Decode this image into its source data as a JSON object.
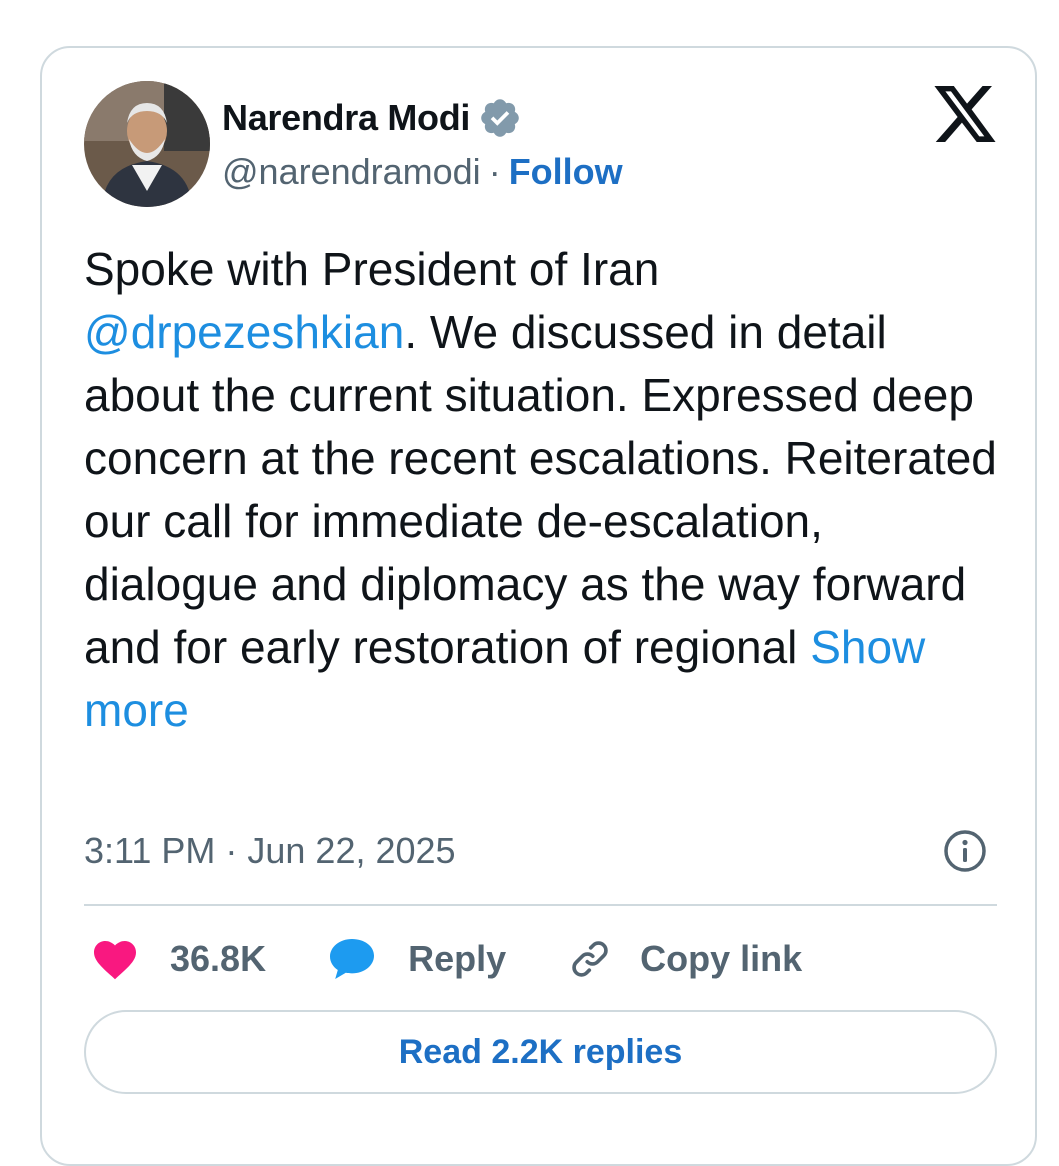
{
  "tweet": {
    "author": {
      "display_name": "Narendra Modi",
      "handle": "@narendramodi",
      "separator": "·",
      "follow_label": "Follow"
    },
    "text": {
      "line1": "Spoke with President of Iran",
      "mention": "@drpezeshkian",
      "body": ". We discussed in detail about the current situation. Expressed deep concern at the recent escalations. Reiterated our call for immediate de-escalation, dialogue and diplomacy as the way forward and for early restoration of regional ",
      "show_more_label": "Show more"
    },
    "timestamp": "3:11 PM · Jun 22, 2025",
    "actions": {
      "likes_count": "36.8K",
      "reply_label": "Reply",
      "copy_link_label": "Copy link"
    },
    "read_replies_label": "Read 2.2K replies"
  },
  "colors": {
    "link_blue": "#1d8ee0",
    "follow_blue": "#1d6fc4",
    "like_pink": "#f91880",
    "reply_blue": "#1d9bf0",
    "muted_gray": "#536471",
    "border": "#cfd9de"
  },
  "icons": {
    "verified": "verified-badge-icon",
    "brand": "x-logo-icon",
    "info": "info-icon",
    "like": "heart-icon",
    "reply": "speech-bubble-icon",
    "copy": "link-icon"
  }
}
